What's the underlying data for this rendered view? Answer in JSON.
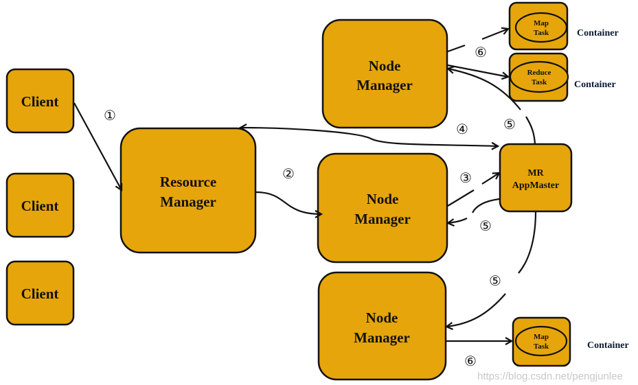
{
  "nodes": {
    "client1": "Client",
    "client2": "Client",
    "client3": "Client",
    "resource_manager": [
      "Resource",
      "Manager"
    ],
    "node_manager_1": [
      "Node",
      "Manager"
    ],
    "node_manager_2": [
      "Node",
      "Manager"
    ],
    "node_manager_3": [
      "Node",
      "Manager"
    ],
    "mr_appmaster": [
      "MR",
      "AppMaster"
    ]
  },
  "containers": [
    {
      "task": [
        "Map",
        "Task"
      ],
      "label": "Container"
    },
    {
      "task": [
        "Reduce",
        "Task"
      ],
      "label": "Container"
    },
    {
      "task": [
        "Map",
        "Task"
      ],
      "label": "Container"
    }
  ],
  "steps": {
    "s1": "①",
    "s2": "②",
    "s3": "③",
    "s4": "④",
    "s5a": "⑤",
    "s5b": "⑤",
    "s5c": "⑤",
    "s6a": "⑥",
    "s6b": "⑥"
  },
  "colors": {
    "node_fill": "#E6A50A",
    "stroke": "#111111"
  },
  "watermark": "https://blog.csdn.net/pengjunlee"
}
